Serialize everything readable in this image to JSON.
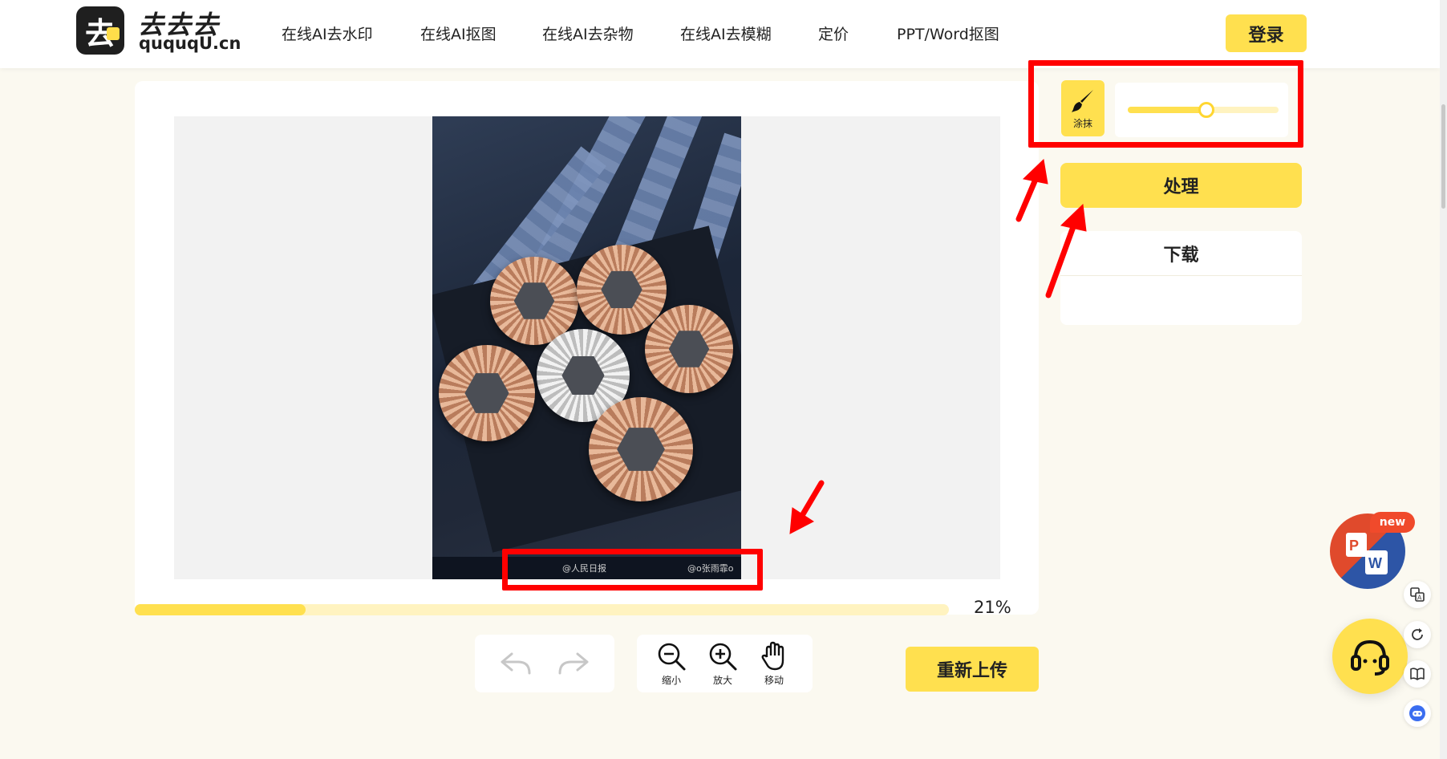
{
  "brand": {
    "logo_glyph": "去",
    "title": "去去去",
    "domain": "ququqU.cn"
  },
  "nav": [
    {
      "label": "在线AI去水印"
    },
    {
      "label": "在线AI抠图"
    },
    {
      "label": "在线AI去杂物"
    },
    {
      "label": "在线AI去模糊"
    },
    {
      "label": "定价"
    },
    {
      "label": "PPT/Word抠图"
    }
  ],
  "header": {
    "login_label": "登录"
  },
  "editor": {
    "watermark_left": "@人民日报",
    "watermark_right": "@o张雨霏o",
    "progress_percent": 21,
    "progress_label": "21%"
  },
  "toolbar": {
    "zoom_out_label": "缩小",
    "zoom_in_label": "放大",
    "move_label": "移动",
    "reupload_label": "重新上传"
  },
  "panel": {
    "brush_label": "涂抹",
    "brush_size_fraction": 0.52,
    "process_label": "处理",
    "download_label": "下载"
  },
  "floating": {
    "new_badge": "new"
  },
  "colors": {
    "accent": "#ffe04f",
    "annotation": "#ff0000",
    "page_bg": "#fbf9f0"
  }
}
